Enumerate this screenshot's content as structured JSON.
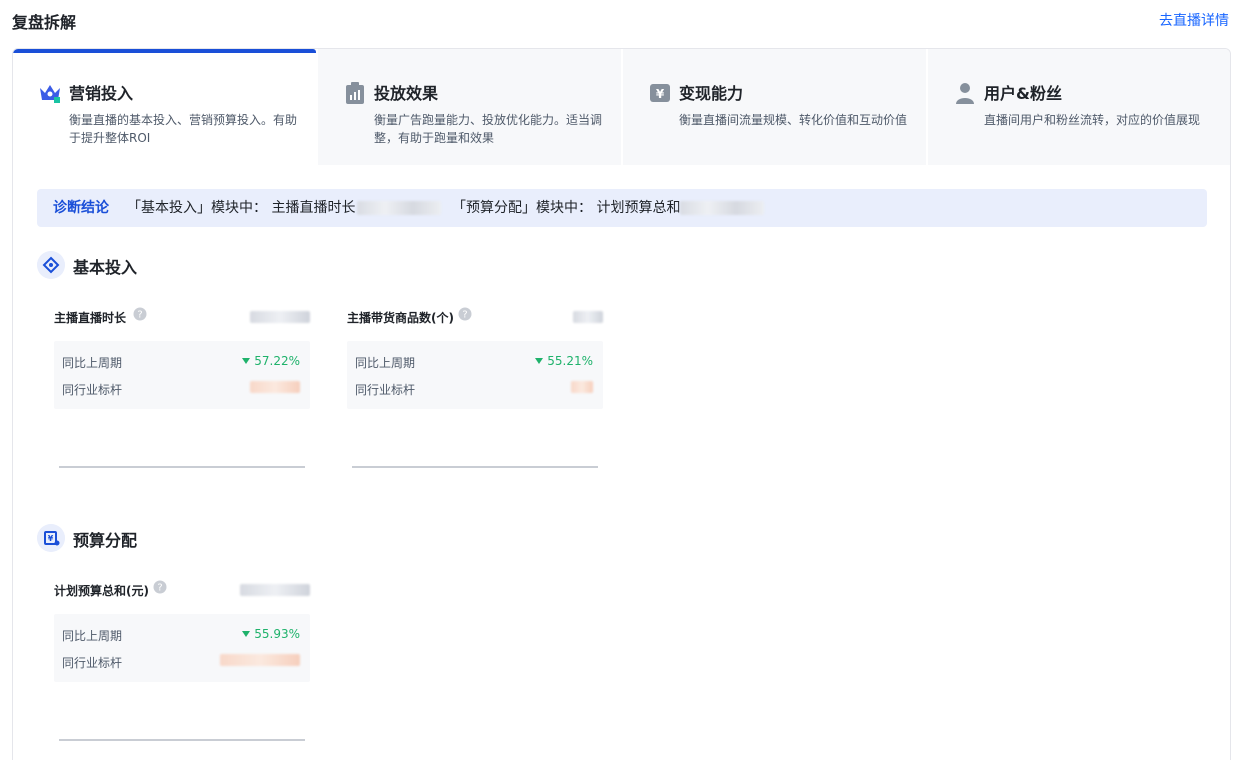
{
  "header": {
    "title": "复盘拆解",
    "link_label": "去直播详情"
  },
  "tabs": [
    {
      "title": "营销投入",
      "desc": "衡量直播的基本投入、营销预算投入。有助于提升整体ROI",
      "icon": "crown-icon",
      "active": true
    },
    {
      "title": "投放效果",
      "desc": "衡量广告跑量能力、投放优化能力。适当调整，有助于跑量和效果",
      "icon": "clipboard-chart-icon",
      "active": false
    },
    {
      "title": "变现能力",
      "desc": "衡量直播间流量规模、转化价值和互动价值",
      "icon": "yen-icon",
      "active": false
    },
    {
      "title": "用户&粉丝",
      "desc": "直播间用户和粉丝流转，对应的价值展现",
      "icon": "user-icon",
      "active": false
    }
  ],
  "diagnosis": {
    "label": "诊断结论",
    "text1": "「基本投入」模块中： 主播直播时长",
    "text2": "「预算分配」模块中： 计划预算总和"
  },
  "sections": {
    "basic": {
      "title": "基本投入",
      "metrics": [
        {
          "name": "主播直播时长",
          "compare_label": "同比上周期",
          "compare_value": "57.22%",
          "bench_label": "同行业标杆"
        },
        {
          "name": "主播带货商品数(个)",
          "compare_label": "同比上周期",
          "compare_value": "55.21%",
          "bench_label": "同行业标杆"
        }
      ]
    },
    "budget": {
      "title": "预算分配",
      "metrics": [
        {
          "name": "计划预算总和(元)",
          "compare_label": "同比上周期",
          "compare_value": "55.93%",
          "bench_label": "同行业标杆"
        }
      ]
    }
  },
  "colors": {
    "accent": "#1a4fd8",
    "link": "#1966ff",
    "down": "#1fb26b",
    "panel_bg": "#f7f8fa",
    "diag_bg": "#e9eefc"
  }
}
